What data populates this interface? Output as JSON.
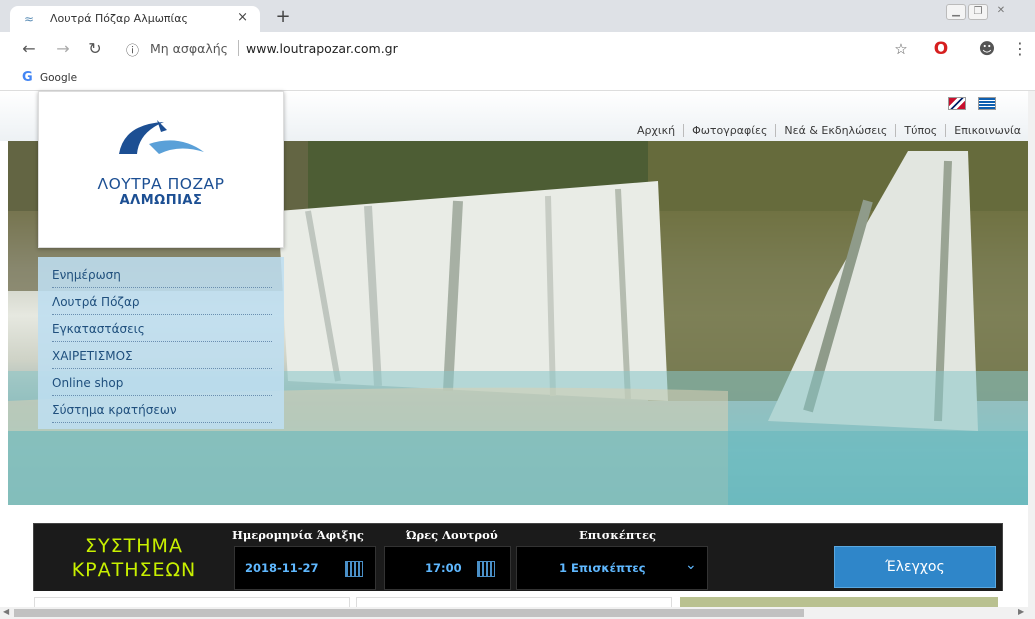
{
  "browser": {
    "tab_title": "Λουτρά Πόζαρ Αλμωπίας",
    "tab_close": "×",
    "new_tab": "+",
    "omnibox_security": "Μη ασφαλής",
    "omnibox_url": "www.loutrapozar.com.gr",
    "bookmark_google": "Google"
  },
  "site": {
    "logo_line1": "ΛΟΥΤΡΑ ΠΟΖΑΡ",
    "logo_line2": "ΑΛΜΩΠΙΑΣ",
    "top_nav": [
      "Αρχική",
      "Φωτογραφίες",
      "Νεά & Εκδηλώσεις",
      "Τύπος",
      "Επικοινωνία"
    ],
    "side_menu": [
      "Ενημέρωση",
      "Λουτρά Πόζαρ",
      "Εγκαταστάσεις",
      "ΧΑΙΡΕΤΙΣΜΟΣ",
      "Online shop",
      "Σύστημα κρατήσεων"
    ]
  },
  "booking": {
    "title_line1": "ΣΥΣΤΗΜΑ",
    "title_line2": "ΚΡΑΤΗΣΕΩΝ",
    "arrival_label": "Ημερομηνία Άφιξης",
    "arrival_value": "2018-11-27",
    "hours_label": "Ώρες Λουτρού",
    "hours_value": "17:00",
    "visitors_label": "Επισκέπτες",
    "visitors_value": "1 Επισκέπτες",
    "check_button": "Έλεγχος"
  },
  "colors": {
    "accent_blue": "#2f86c9",
    "logo_blue": "#1c4f93",
    "booking_title_green": "#c8f000",
    "booking_value_blue": "#5fb8ff"
  }
}
